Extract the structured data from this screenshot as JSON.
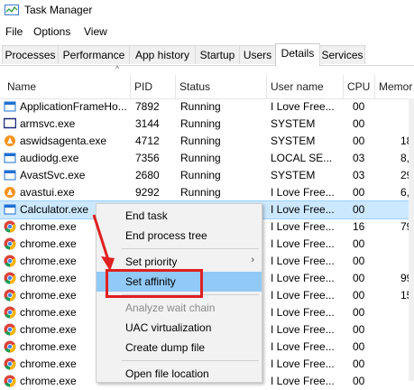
{
  "window": {
    "title": "Task Manager"
  },
  "menu": [
    "File",
    "Options",
    "View"
  ],
  "tabs": [
    "Processes",
    "Performance",
    "App history",
    "Startup",
    "Users",
    "Details",
    "Services"
  ],
  "active_tab": "Details",
  "columns": [
    "Name",
    "PID",
    "Status",
    "User name",
    "CPU",
    "Memor"
  ],
  "rows": [
    {
      "name": "ApplicationFrameHo...",
      "pid": "7892",
      "status": "Running",
      "user": "I Love Free...",
      "cpu": "00",
      "mem": "",
      "icon": "app-frame-icon"
    },
    {
      "name": "armsvc.exe",
      "pid": "3144",
      "status": "Running",
      "user": "SYSTEM",
      "cpu": "00",
      "mem": "",
      "icon": "window-icon"
    },
    {
      "name": "aswidsagenta.exe",
      "pid": "4712",
      "status": "Running",
      "user": "SYSTEM",
      "cpu": "00",
      "mem": "18,",
      "icon": "avast-icon"
    },
    {
      "name": "audiodg.exe",
      "pid": "7356",
      "status": "Running",
      "user": "LOCAL SE...",
      "cpu": "03",
      "mem": "8,0",
      "icon": "app-frame-icon"
    },
    {
      "name": "AvastSvc.exe",
      "pid": "2680",
      "status": "Running",
      "user": "SYSTEM",
      "cpu": "03",
      "mem": "29,",
      "icon": "app-frame-icon"
    },
    {
      "name": "avastui.exe",
      "pid": "9292",
      "status": "Running",
      "user": "I Love Free...",
      "cpu": "00",
      "mem": "6,",
      "icon": "avast-icon"
    },
    {
      "name": "Calculator.exe",
      "pid": "",
      "status": "",
      "user": "I Love Free...",
      "cpu": "00",
      "mem": "",
      "icon": "app-frame-icon",
      "selected": true
    },
    {
      "name": "chrome.exe",
      "pid": "",
      "status": "",
      "user": "I Love Free...",
      "cpu": "16",
      "mem": "79,",
      "icon": "chrome-icon"
    },
    {
      "name": "chrome.exe",
      "pid": "",
      "status": "",
      "user": "I Love Free...",
      "cpu": "00",
      "mem": "",
      "icon": "chrome-icon"
    },
    {
      "name": "chrome.exe",
      "pid": "",
      "status": "",
      "user": "I Love Free...",
      "cpu": "00",
      "mem": "",
      "icon": "chrome-icon"
    },
    {
      "name": "chrome.exe",
      "pid": "",
      "status": "",
      "user": "I Love Free...",
      "cpu": "00",
      "mem": "99,",
      "icon": "chrome-icon"
    },
    {
      "name": "chrome.exe",
      "pid": "",
      "status": "",
      "user": "I Love Free...",
      "cpu": "00",
      "mem": "15,",
      "icon": "chrome-icon"
    },
    {
      "name": "chrome.exe",
      "pid": "",
      "status": "",
      "user": "I Love Free...",
      "cpu": "00",
      "mem": "",
      "icon": "chrome-icon"
    },
    {
      "name": "chrome.exe",
      "pid": "",
      "status": "",
      "user": "I Love Free...",
      "cpu": "00",
      "mem": "",
      "icon": "chrome-icon"
    },
    {
      "name": "chrome.exe",
      "pid": "",
      "status": "",
      "user": "I Love Free...",
      "cpu": "00",
      "mem": "",
      "icon": "chrome-icon"
    },
    {
      "name": "chrome.exe",
      "pid": "",
      "status": "",
      "user": "I Love Free...",
      "cpu": "00",
      "mem": "",
      "icon": "chrome-icon"
    },
    {
      "name": "chrome.exe",
      "pid": "",
      "status": "",
      "user": "I Love Free...",
      "cpu": "00",
      "mem": "",
      "icon": "chrome-icon"
    }
  ],
  "context_menu": [
    {
      "label": "End task"
    },
    {
      "label": "End process tree"
    },
    {
      "separator": true
    },
    {
      "label": "Set priority",
      "submenu": true
    },
    {
      "label": "Set affinity",
      "highlighted": true
    },
    {
      "separator": true
    },
    {
      "label": "Analyze wait chain",
      "disabled": true
    },
    {
      "label": "UAC virtualization"
    },
    {
      "label": "Create dump file"
    },
    {
      "separator": true
    },
    {
      "label": "Open file location"
    }
  ],
  "colors": {
    "selection": "#cce8ff",
    "menu_highlight": "#91c9f7",
    "annotation": "#e02020"
  }
}
